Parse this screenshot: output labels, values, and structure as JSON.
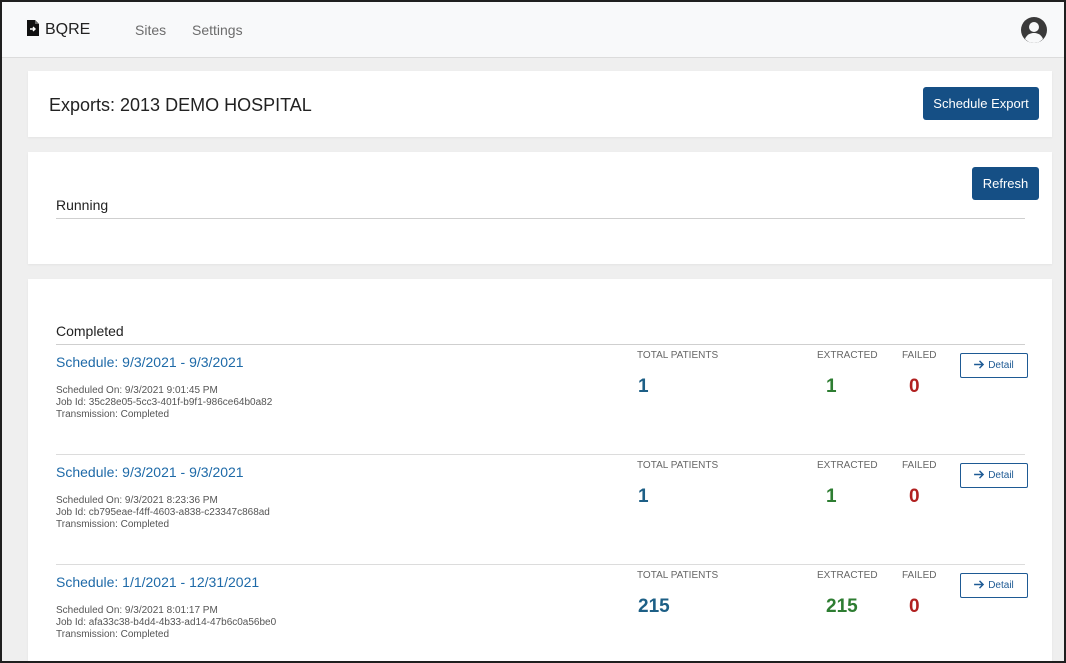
{
  "nav": {
    "brand": "BQRE",
    "links": [
      "Sites",
      "Settings"
    ]
  },
  "header": {
    "title": "Exports: 2013 DEMO HOSPITAL",
    "schedule_button": "Schedule Export"
  },
  "running": {
    "title": "Running",
    "refresh_button": "Refresh"
  },
  "completed": {
    "title": "Completed",
    "labels": {
      "total": "TOTAL PATIENTS",
      "extracted": "EXTRACTED",
      "failed": "FAILED",
      "detail": "Detail"
    },
    "exports": [
      {
        "schedule": "Schedule: 9/3/2021 - 9/3/2021",
        "scheduled_on": "Scheduled On: 9/3/2021 9:01:45 PM",
        "job_id": "Job Id: 35c28e05-5cc3-401f-b9f1-986ce64b0a82",
        "transmission": "Transmission: Completed",
        "total": "1",
        "extracted": "1",
        "failed": "0"
      },
      {
        "schedule": "Schedule: 9/3/2021 - 9/3/2021",
        "scheduled_on": "Scheduled On: 9/3/2021 8:23:36 PM",
        "job_id": "Job Id: cb795eae-f4ff-4603-a838-c23347c868ad",
        "transmission": "Transmission: Completed",
        "total": "1",
        "extracted": "1",
        "failed": "0"
      },
      {
        "schedule": "Schedule: 1/1/2021 - 12/31/2021",
        "scheduled_on": "Scheduled On: 9/3/2021 8:01:17 PM",
        "job_id": "Job Id: afa33c38-b4d4-4b33-ad14-47b6c0a56be0",
        "transmission": "Transmission: Completed",
        "total": "215",
        "extracted": "215",
        "failed": "0"
      }
    ]
  },
  "colors": {
    "primary": "#154f85",
    "link": "#1e6aa8",
    "total": "#1d5f86",
    "extracted": "#2e7d32",
    "failed": "#b02020"
  }
}
